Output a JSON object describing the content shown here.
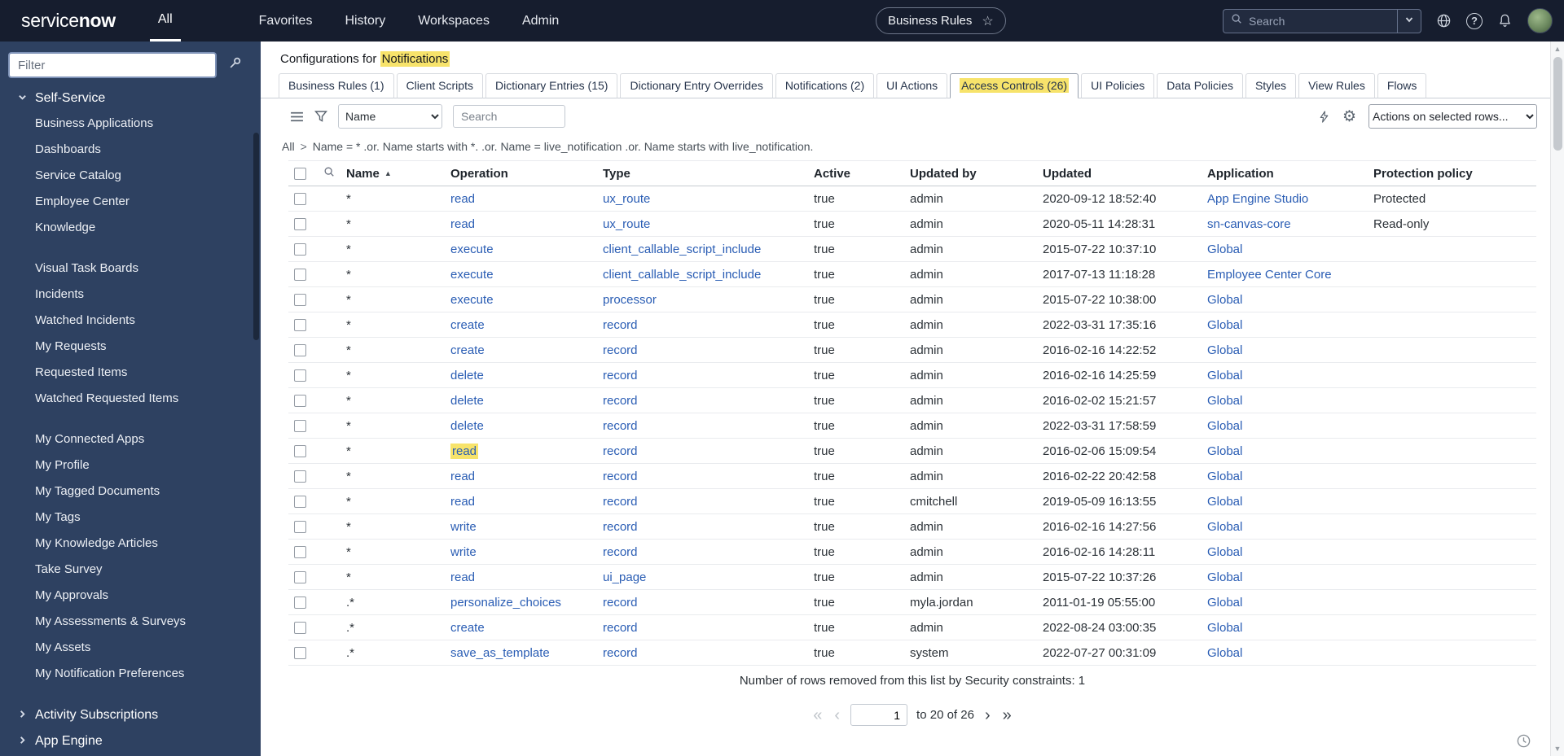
{
  "colors": {
    "header_bg": "#161d2e",
    "sidebar_bg": "#2e4161",
    "link": "#2a5db4",
    "highlight": "#f7e36b"
  },
  "icons": {
    "gear": "⚙",
    "star": "☆",
    "sort_asc": "▲",
    "first_page": "«",
    "prev_page": "‹",
    "next_page": "›",
    "last_page": "»",
    "question": "?",
    "scroll_up": "▲",
    "scroll_down": "▼"
  },
  "header": {
    "logo_service": "service",
    "logo_now": "now",
    "nav_all": "All",
    "nav_items": [
      "Favorites",
      "History",
      "Workspaces",
      "Admin"
    ],
    "context_pill": "Business Rules",
    "search_placeholder": "Search"
  },
  "sidebar": {
    "filter_placeholder": "Filter",
    "section": {
      "label": "Self-Service",
      "groups": [
        [
          "Business Applications",
          "Dashboards",
          "Service Catalog",
          "Employee Center",
          "Knowledge"
        ],
        [
          "Visual Task Boards",
          "Incidents",
          "Watched Incidents",
          "My Requests",
          "Requested Items",
          "Watched Requested Items"
        ],
        [
          "My Connected Apps",
          "My Profile",
          "My Tagged Documents",
          "My Tags",
          "My Knowledge Articles",
          "Take Survey",
          "My Approvals",
          "My Assessments & Surveys",
          "My Assets",
          "My Notification Preferences"
        ]
      ]
    },
    "collapsed_sections": [
      "Activity Subscriptions",
      "App Engine"
    ]
  },
  "main": {
    "title_prefix": "Configurations for",
    "title_highlight": "Notifications",
    "tabs": [
      {
        "label": "Business Rules (1)"
      },
      {
        "label": "Client Scripts"
      },
      {
        "label": "Dictionary Entries (15)"
      },
      {
        "label": "Dictionary Entry Overrides"
      },
      {
        "label": "Notifications (2)"
      },
      {
        "label": "UI Actions"
      },
      {
        "label": "Access Controls (26)",
        "active": true,
        "highlighted": true
      },
      {
        "label": "UI Policies"
      },
      {
        "label": "Data Policies"
      },
      {
        "label": "Styles"
      },
      {
        "label": "View Rules"
      },
      {
        "label": "Flows"
      }
    ],
    "toolbar": {
      "search_column": "Name",
      "search_placeholder": "Search",
      "actions_label": "Actions on selected rows..."
    },
    "breadcrumb": {
      "root": "All",
      "separator": ">",
      "query": "Name = * .or. Name starts with *. .or. Name = live_notification .or. Name starts with live_notification."
    },
    "table": {
      "columns": [
        "Name",
        "Operation",
        "Type",
        "Active",
        "Updated by",
        "Updated",
        "Application",
        "Protection policy"
      ],
      "sorted_column": "Name",
      "rows": [
        {
          "name": "*",
          "operation": "read",
          "type": "ux_route",
          "active": "true",
          "updated_by": "admin",
          "updated": "2020-09-12 18:52:40",
          "application": "App Engine Studio",
          "protection": "Protected"
        },
        {
          "name": "*",
          "operation": "read",
          "type": "ux_route",
          "active": "true",
          "updated_by": "admin",
          "updated": "2020-05-11 14:28:31",
          "application": "sn-canvas-core",
          "protection": "Read-only"
        },
        {
          "name": "*",
          "operation": "execute",
          "type": "client_callable_script_include",
          "active": "true",
          "updated_by": "admin",
          "updated": "2015-07-22 10:37:10",
          "application": "Global",
          "protection": ""
        },
        {
          "name": "*",
          "operation": "execute",
          "type": "client_callable_script_include",
          "active": "true",
          "updated_by": "admin",
          "updated": "2017-07-13 11:18:28",
          "application": "Employee Center Core",
          "protection": ""
        },
        {
          "name": "*",
          "operation": "execute",
          "type": "processor",
          "active": "true",
          "updated_by": "admin",
          "updated": "2015-07-22 10:38:00",
          "application": "Global",
          "protection": ""
        },
        {
          "name": "*",
          "operation": "create",
          "type": "record",
          "active": "true",
          "updated_by": "admin",
          "updated": "2022-03-31 17:35:16",
          "application": "Global",
          "protection": ""
        },
        {
          "name": "*",
          "operation": "create",
          "type": "record",
          "active": "true",
          "updated_by": "admin",
          "updated": "2016-02-16 14:22:52",
          "application": "Global",
          "protection": ""
        },
        {
          "name": "*",
          "operation": "delete",
          "type": "record",
          "active": "true",
          "updated_by": "admin",
          "updated": "2016-02-16 14:25:59",
          "application": "Global",
          "protection": ""
        },
        {
          "name": "*",
          "operation": "delete",
          "type": "record",
          "active": "true",
          "updated_by": "admin",
          "updated": "2016-02-02 15:21:57",
          "application": "Global",
          "protection": ""
        },
        {
          "name": "*",
          "operation": "delete",
          "type": "record",
          "active": "true",
          "updated_by": "admin",
          "updated": "2022-03-31 17:58:59",
          "application": "Global",
          "protection": ""
        },
        {
          "name": "*",
          "operation": "read",
          "operation_highlight": true,
          "type": "record",
          "active": "true",
          "updated_by": "admin",
          "updated": "2016-02-06 15:09:54",
          "application": "Global",
          "protection": ""
        },
        {
          "name": "*",
          "operation": "read",
          "type": "record",
          "active": "true",
          "updated_by": "admin",
          "updated": "2016-02-22 20:42:58",
          "application": "Global",
          "protection": ""
        },
        {
          "name": "*",
          "operation": "read",
          "type": "record",
          "active": "true",
          "updated_by": "cmitchell",
          "updated": "2019-05-09 16:13:55",
          "application": "Global",
          "protection": ""
        },
        {
          "name": "*",
          "operation": "write",
          "type": "record",
          "active": "true",
          "updated_by": "admin",
          "updated": "2016-02-16 14:27:56",
          "application": "Global",
          "protection": ""
        },
        {
          "name": "*",
          "operation": "write",
          "type": "record",
          "active": "true",
          "updated_by": "admin",
          "updated": "2016-02-16 14:28:11",
          "application": "Global",
          "protection": ""
        },
        {
          "name": "*",
          "operation": "read",
          "type": "ui_page",
          "active": "true",
          "updated_by": "admin",
          "updated": "2015-07-22 10:37:26",
          "application": "Global",
          "protection": ""
        },
        {
          "name": ".*",
          "operation": "personalize_choices",
          "type": "record",
          "active": "true",
          "updated_by": "myla.jordan",
          "updated": "2011-01-19 05:55:00",
          "application": "Global",
          "protection": ""
        },
        {
          "name": ".*",
          "operation": "create",
          "type": "record",
          "active": "true",
          "updated_by": "admin",
          "updated": "2022-08-24 03:00:35",
          "application": "Global",
          "protection": ""
        },
        {
          "name": ".*",
          "operation": "save_as_template",
          "type": "record",
          "active": "true",
          "updated_by": "system",
          "updated": "2022-07-27 00:31:09",
          "application": "Global",
          "protection": ""
        }
      ]
    },
    "security_note": "Number of rows removed from this list by Security constraints: 1",
    "pagination": {
      "current_page": "1",
      "range_label": "to 20 of 26"
    }
  }
}
